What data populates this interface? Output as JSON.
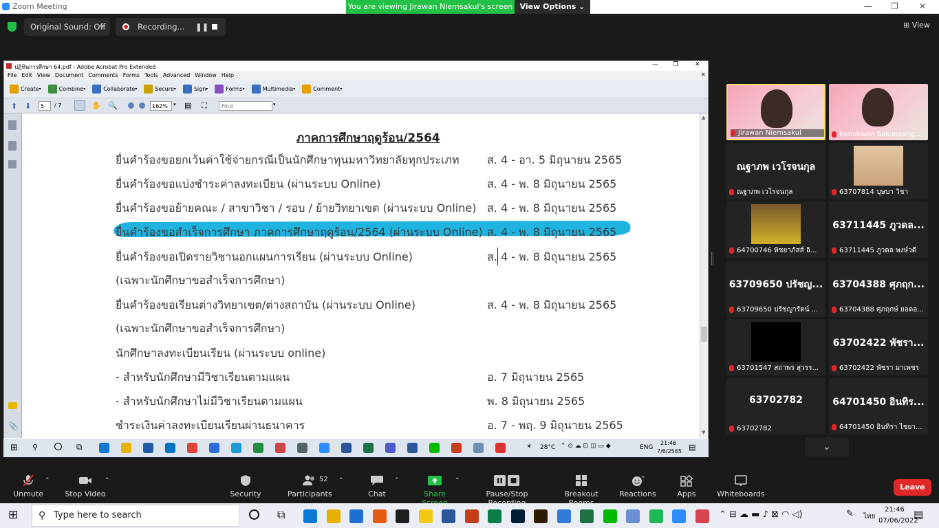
{
  "zoom": {
    "title": "Zoom Meeting",
    "banner": "You are viewing Jirawan Niemsakul's screen",
    "view_options": "View Options",
    "original_sound": "Original Sound: Off",
    "recording": "Recording...",
    "view": "View"
  },
  "acrobat": {
    "title": "ปฏิทินการศึกษา 64.pdf - Adobe Acrobat Pro Extended",
    "menu": [
      "File",
      "Edit",
      "View",
      "Document",
      "Comments",
      "Forms",
      "Tools",
      "Advanced",
      "Window",
      "Help"
    ],
    "tools": [
      "Create",
      "Combine",
      "Collaborate",
      "Secure",
      "Sign",
      "Forms",
      "Multimedia",
      "Comment"
    ],
    "page_current": "5",
    "page_total": "/ 7",
    "zoom_level": "162%",
    "find_placeholder": "Find"
  },
  "document": {
    "heading": "ภาคการศึกษาฤดูร้อน/2564",
    "rows": [
      {
        "item": "ยื่นคำร้องขอยกเว้นค่าใช้จ่ายกรณีเป็นนักศึกษาทุนมหาวิทยาลัยทุกประเภท",
        "date": "ส. 4 - อา. 5 มิถุนายน 2565"
      },
      {
        "item": "ยื่นคำร้องขอแบ่งชำระค่าลงทะเบียน (ผ่านระบบ Online)",
        "date": "ส. 4 - พ. 8 มิถุนายน 2565"
      },
      {
        "item": "ยื่นคำร้องขอย้ายคณะ / สาขาวิชา / รอบ / ย้ายวิทยาเขต (ผ่านระบบ Online)",
        "date": "ส. 4 - พ. 8 มิถุนายน 2565"
      },
      {
        "item": "ยื่นคำร้องขอสำเร็จการศึกษา ภาคการศึกษาฤดูร้อน/2564 (ผ่านระบบ Online)",
        "date": "ส. 4 - พ. 8 มิถุนายน 2565"
      },
      {
        "item": "ยื่นคำร้องขอเปิดรายวิชานอกแผนการเรียน (ผ่านระบบ Online)",
        "date": "ส. 4 - พ. 8 มิถุนายน 2565"
      },
      {
        "item": "(เฉพาะนักศึกษาขอสำเร็จการศึกษา)",
        "date": ""
      },
      {
        "item": "ยื่นคำร้องขอเรียนต่างวิทยาเขต/ต่างสถาบัน (ผ่านระบบ Online)",
        "date": "ส. 4 - พ. 8 มิถุนายน 2565"
      },
      {
        "item": "(เฉพาะนักศึกษาขอสำเร็จการศึกษา)",
        "date": ""
      },
      {
        "item": "นักศึกษาลงทะเบียนเรียน (ผ่านระบบ online)",
        "date": ""
      },
      {
        "item": "  -  สำหรับนักศึกษามีวิชาเรียนตามแผน",
        "date": "อ. 7 มิถุนายน 2565"
      },
      {
        "item": "  -  สำหรับนักศึกษาไม่มีวิชาเรียนตามแผน",
        "date": "พ. 8 มิถุนายน 2565"
      },
      {
        "item": "ชำระเงินค่าลงทะเบียนเรียนผ่านธนาคาร",
        "date": "อ. 7 - พฤ. 9 มิถุนายน 2565"
      }
    ]
  },
  "shared_taskbar": {
    "temp": "28°C",
    "lang": "ENG",
    "time": "21:46",
    "date": "7/6/2565"
  },
  "gallery": [
    {
      "name": "Jirawan Niemsakul",
      "big": "",
      "kind": "video"
    },
    {
      "name": "Kanokwan Sakunsong...",
      "big": "",
      "kind": "video"
    },
    {
      "name": "ณฐาภพ เวโรจนกุล",
      "big": "ณฐาภพ เวโรจนกุล",
      "kind": "text"
    },
    {
      "name": "63707814 บุษบา วิชา",
      "big": "",
      "kind": "photo"
    },
    {
      "name": "64700746 พิชยาภัสส์ อิ...",
      "big": "",
      "kind": "photo2"
    },
    {
      "name": "63711445 ภูวดล พงษ์วดี",
      "big": "63711445 ภูวดล...",
      "kind": "text"
    },
    {
      "name": "63709650 ปรัชญารัตน์ ...",
      "big": "63709650 ปรัชญ...",
      "kind": "text"
    },
    {
      "name": "63704388 ศุภฤกษ์ ยอดอ...",
      "big": "63704388 ศุภฤก...",
      "kind": "text"
    },
    {
      "name": "63701547 สถาพร สุวรร...",
      "big": "",
      "kind": "black"
    },
    {
      "name": "63702422 พัชรา มาเพชร",
      "big": "63702422 พัชรา...",
      "kind": "text"
    },
    {
      "name": "63702782",
      "big": "63702782",
      "kind": "text"
    },
    {
      "name": "64701450 อินทิรา ไชยา...",
      "big": "64701450 อินทิร...",
      "kind": "text"
    }
  ],
  "toolbar": {
    "unmute": "Unmute",
    "stop_video": "Stop Video",
    "security": "Security",
    "participants": "Participants",
    "participants_count": "52",
    "chat": "Chat",
    "share_screen": "Share Screen",
    "pause_recording": "Pause/Stop Recording",
    "breakout": "Breakout Rooms",
    "reactions": "Reactions",
    "apps": "Apps",
    "whiteboards": "Whiteboards",
    "leave": "Leave"
  },
  "host_taskbar": {
    "search": "Type here to search",
    "lang": "ไทย",
    "time": "21:46",
    "date": "07/06/2022"
  },
  "colors": {
    "highlight": "#1fb3e0",
    "share_green": "#23c046",
    "leave_red": "#e02828"
  }
}
